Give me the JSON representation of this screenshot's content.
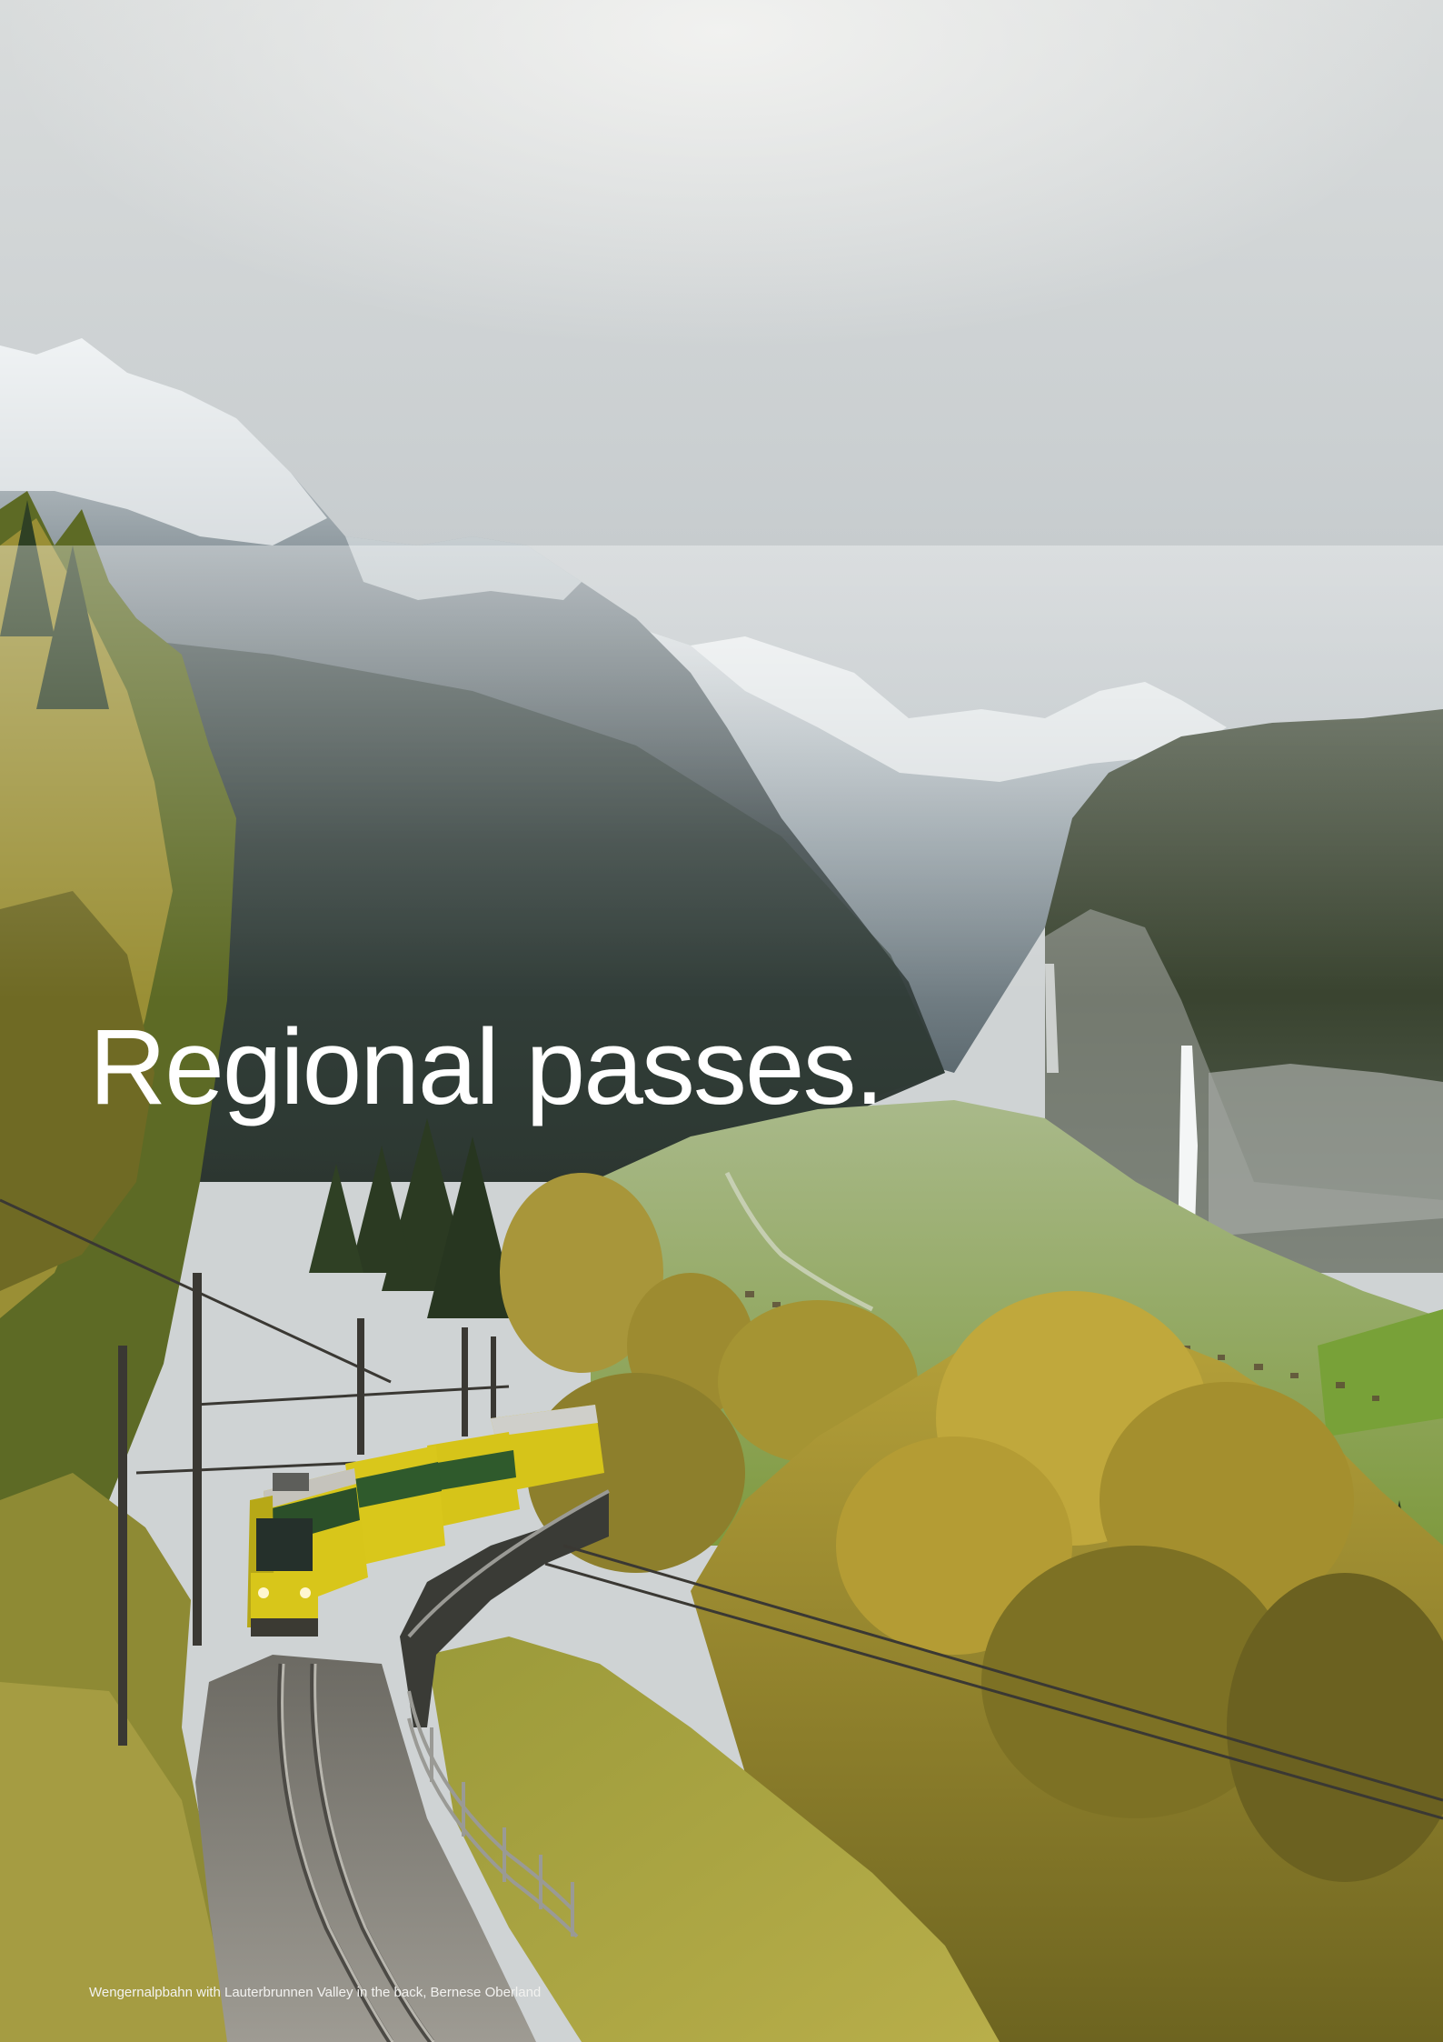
{
  "page": {
    "headline": "Regional passes.",
    "caption": "Wengernalpbahn with Lauterbrunnen Valley in the back, Bernese Oberland"
  },
  "colors": {
    "headline_text": "#ffffff",
    "caption_text": "#f2f2f0",
    "train_yellow": "#d6c419",
    "train_green": "#2f5a2c"
  }
}
